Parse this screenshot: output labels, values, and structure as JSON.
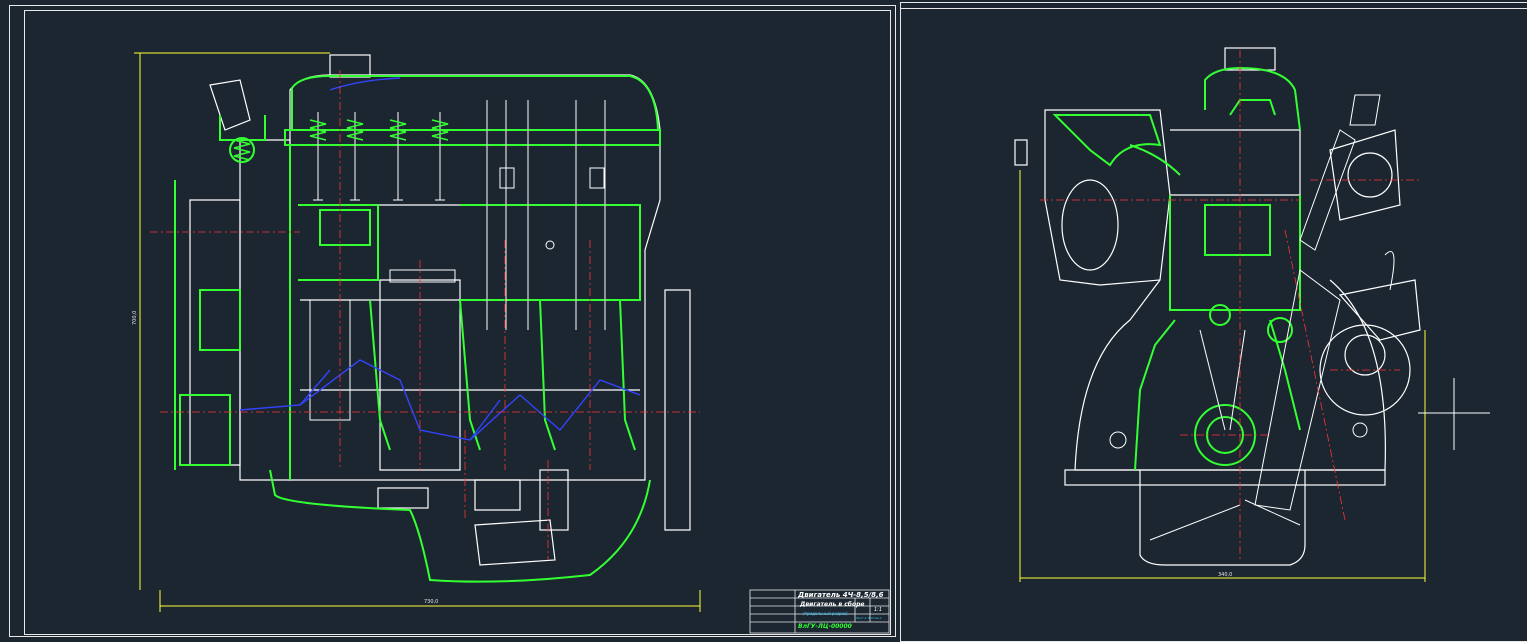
{
  "colors": {
    "background": "#1b2630",
    "outline": "#ffffff",
    "hatch": "#33ff33",
    "centerline": "#ff3333",
    "hidden": "#3344ff",
    "dimension": "#ffff33",
    "titleblock_text": "#33ccff"
  },
  "left_sheet": {
    "dimension_height": "700,0",
    "dimension_width": "730,0",
    "title_block": {
      "title_line1": "Двигатель 4Ч-8,5/8,6",
      "title_line2": "Двигатель в сборе",
      "subtitle": "(продольный разрез)",
      "doc_code": "ВлГУ-ЛЦ-00000",
      "scale": "1:1",
      "sheet_info": "Лист 2 Листов 2"
    }
  },
  "right_sheet": {
    "dimension_width": "340,0"
  },
  "crosshair": "cursor-crosshair"
}
